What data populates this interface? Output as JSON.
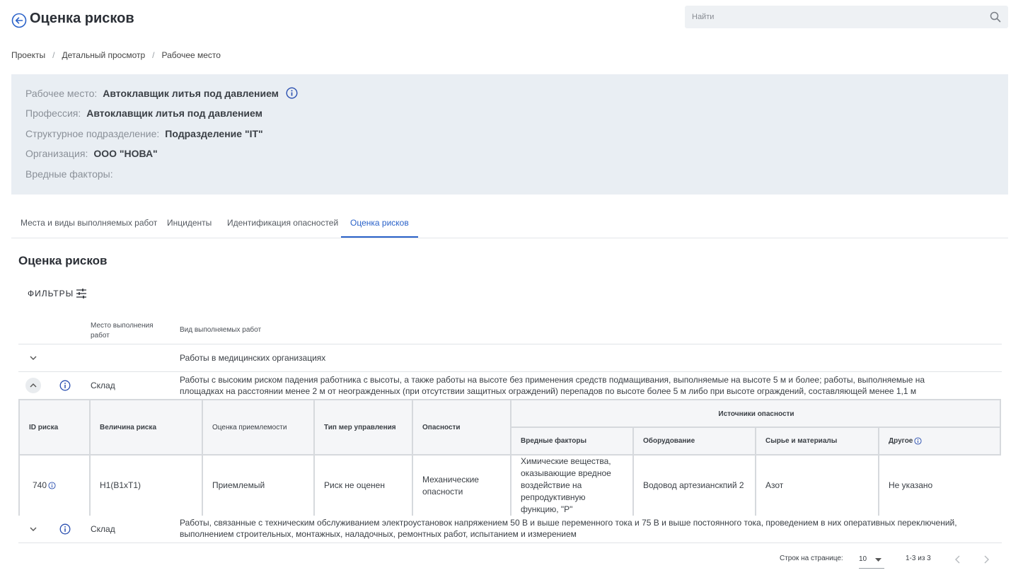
{
  "header": {
    "title": "Оценка рисков",
    "search_placeholder": "Найти"
  },
  "breadcrumb": [
    "Проекты",
    "Детальный просмотр",
    "Рабочее место"
  ],
  "info": {
    "workplace_label": "Рабочее место:",
    "workplace_value": "Автоклавщик литья под давлением",
    "profession_label": "Профессия:",
    "profession_value": "Автоклавщик литья под давлением",
    "department_label": "Структурное подразделение:",
    "department_value": "Подразделение \"IT\"",
    "organization_label": "Организация:",
    "organization_value": "ООО \"НОВА\"",
    "harmful_label": "Вредные факторы:",
    "harmful_value": ""
  },
  "tabs": [
    {
      "label": "Места и виды выполняемых работ",
      "active": false
    },
    {
      "label": "Инциденты",
      "active": false
    },
    {
      "label": "Идентификация опасностей",
      "active": false
    },
    {
      "label": "Оценка рисков",
      "active": true
    }
  ],
  "section_title": "Оценка рисков",
  "filters_label": "ФИЛЬТРЫ",
  "table": {
    "col_place": "Место выполнения работ",
    "col_kind": "Вид выполняемых работ",
    "rows": [
      {
        "place": "",
        "kind": "Работы в медицинских организациях",
        "expanded": false
      },
      {
        "place": "Склад",
        "kind": "Работы с высоким риском падения работника с высоты, а также работы на высоте без применения средств подмащивания, выполняемые на высоте 5 м и более; работы, выполняемые на площадках на расстоянии менее 2 м от неогражденных (при отсутствии защитных ограждений) перепадов по высоте более 5 м либо при высоте ограждений, составляющей менее 1,1 м",
        "expanded": true
      },
      {
        "place": "Склад",
        "kind": "Работы, связанные с техническим обслуживанием электроустановок напряжением 50 В и выше переменного тока и 75 В и выше постоянного тока, проведением в них оперативных переключений, выполнением строительных, монтажных, наладочных, ремонтных работ, испытанием и измерением",
        "expanded": false
      }
    ]
  },
  "risk_table": {
    "headers": {
      "id": "ID риска",
      "magnitude": "Величина риска",
      "acceptability": "Оценка приемлемости",
      "measures": "Тип мер управления",
      "hazards": "Опасности",
      "sources": "Источники опасности",
      "harmful": "Вредные факторы",
      "equipment": "Оборудование",
      "materials": "Сырье и материалы",
      "other": "Другое"
    },
    "row": {
      "id": "740",
      "magnitude": "Н1(В1хТ1)",
      "acceptability": "Приемлемый",
      "measures": "Риск не оценен",
      "hazards": "Механические опасности",
      "harmful": "Химические вещества, оказывающие вредное воздействие на репродуктивную функцию, \"Р\"",
      "equipment": "Водовод артезианскпий 2",
      "materials": "Азот",
      "other": "Не указано"
    }
  },
  "pagination": {
    "rows_label": "Строк на странице:",
    "rows_value": "10",
    "range": "1-3 из 3"
  },
  "colors": {
    "accent": "#2a62c9",
    "panel_bg": "#e9eef3",
    "acceptable": "#2e7d32"
  }
}
